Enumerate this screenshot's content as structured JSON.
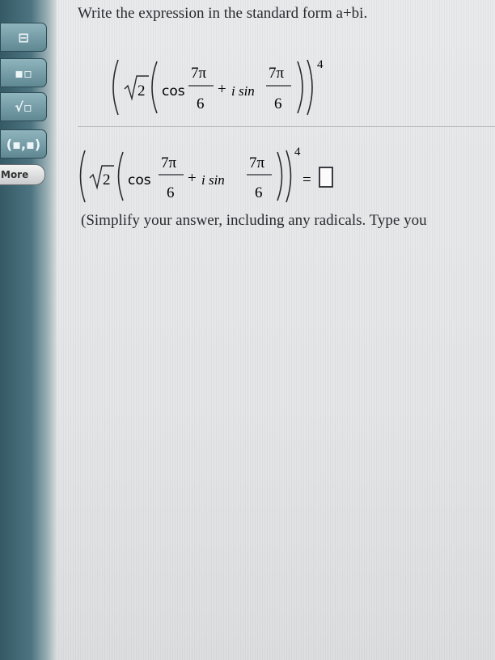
{
  "question": {
    "prefix": "Write the expression in the standard form ",
    "form": "a+bi."
  },
  "expression": {
    "radical": "2",
    "cos_label": "cos",
    "sin_label": "i sin",
    "plus": "+",
    "numerator": "7π",
    "denominator": "6",
    "exponent": "4"
  },
  "answer": {
    "equals": "="
  },
  "instruction": "(Simplify your answer, including any radicals. Type you",
  "palette": {
    "more_label": "More"
  },
  "colors": {
    "palette_bg": "#4c7480",
    "page_bg": "#ecedee",
    "text": "#2a2a30"
  }
}
